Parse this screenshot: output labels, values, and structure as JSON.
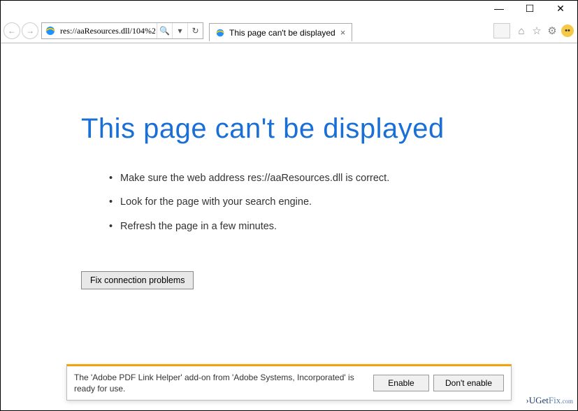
{
  "window": {
    "min": "—",
    "max": "☐",
    "close": "✕"
  },
  "toolbar": {
    "back": "←",
    "forward": "→",
    "url": "res://aaResources.dll/104%2",
    "search": "🔍",
    "dropdown": "▾",
    "refresh": "↻"
  },
  "tab": {
    "title": "This page can't be displayed",
    "close": "×"
  },
  "toolbar_icons": {
    "home": "⌂",
    "favorites": "☆",
    "settings": "⚙"
  },
  "error": {
    "title": "This page can't be displayed",
    "suggestions": [
      "Make sure the web address res://aaResources.dll is correct.",
      "Look for the page with your search engine.",
      "Refresh the page in a few minutes."
    ],
    "fix_button": "Fix connection problems"
  },
  "notification": {
    "text": "The 'Adobe PDF Link Helper' add-on from 'Adobe Systems, Incorporated' is ready for use.",
    "enable": "Enable",
    "dont_enable": "Don't enable"
  },
  "watermark": {
    "a": "›UGet",
    "b": "Fix",
    "c": ".com"
  }
}
